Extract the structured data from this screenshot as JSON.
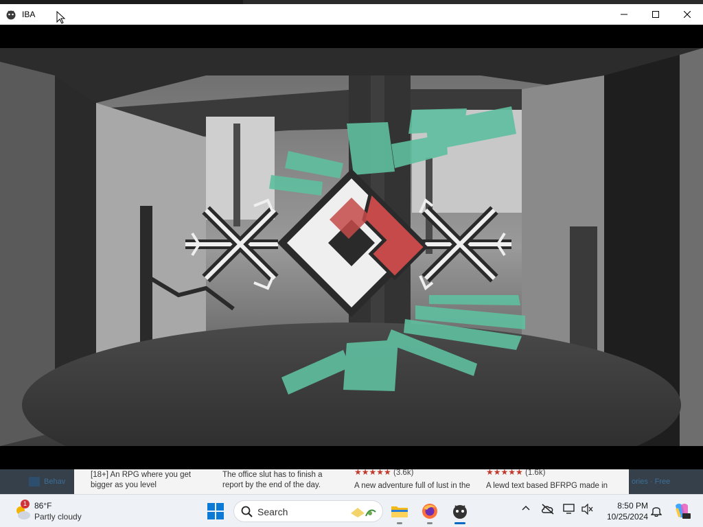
{
  "window": {
    "title": "IBA",
    "controls": [
      "minimize-icon",
      "maximize-icon",
      "close-icon"
    ]
  },
  "game": {
    "scene": "rotating-logo-over-spiral-staircase",
    "colors": {
      "teal_steps": "#5fbf9f",
      "logo_red": "#c64a4a",
      "logo_white": "#f2f2f2",
      "outline": "#2a2a2a"
    }
  },
  "webpage": {
    "left_link": "Behav",
    "right_link": "ories · Free",
    "cards": [
      {
        "line1": "[18+] An RPG where you get",
        "line2": "bigger as you level",
        "rating": "",
        "count": ""
      },
      {
        "line1": "The office slut has to finish a",
        "line2": "report by the end of the day.",
        "rating": "",
        "count": ""
      },
      {
        "line1": "A new adventure full of lust in the",
        "line2": "",
        "rating": "★★★★★",
        "count": "(3.6k)"
      },
      {
        "line1": "A lewd text based BFRPG made in",
        "line2": "",
        "rating": "★★★★★",
        "count": "(1.6k)"
      }
    ]
  },
  "taskbar": {
    "weather": {
      "badge": "1",
      "temp": "86°F",
      "condition": "Partly cloudy"
    },
    "search_label": "Search",
    "apps": [
      "file-explorer-icon",
      "firefox-icon",
      "iba-app-icon"
    ],
    "time": "8:50 PM",
    "date": "10/25/2024",
    "accent": "#0067c0"
  }
}
